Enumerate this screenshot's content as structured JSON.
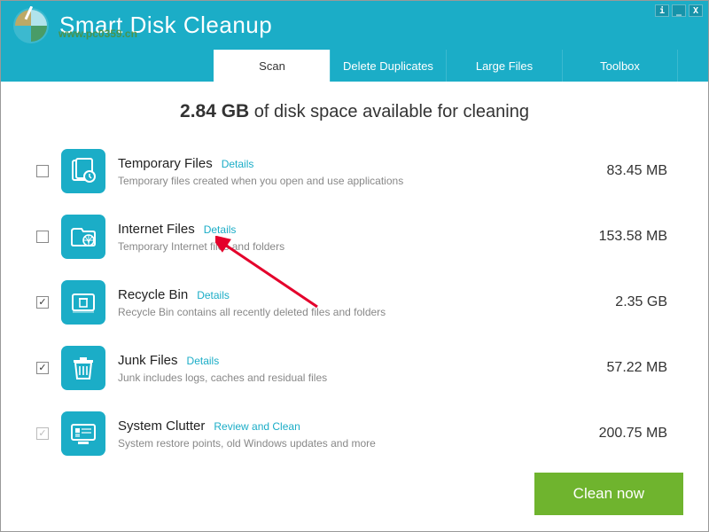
{
  "app_title": "Smart Disk Cleanup",
  "watermark": "www.pc0359.cn",
  "tabs": [
    {
      "label": "Scan",
      "active": true
    },
    {
      "label": "Delete Duplicates",
      "active": false
    },
    {
      "label": "Large Files",
      "active": false
    },
    {
      "label": "Toolbox",
      "active": false
    }
  ],
  "summary": {
    "amount": "2.84 GB",
    "suffix": " of disk space available for cleaning"
  },
  "items": [
    {
      "checked": false,
      "locked": false,
      "icon": "temp-icon",
      "title": "Temporary Files",
      "link": "Details",
      "desc": "Temporary files created when you open and use applications",
      "size": "83.45 MB"
    },
    {
      "checked": false,
      "locked": false,
      "icon": "internet-icon",
      "title": "Internet Files",
      "link": "Details",
      "desc": "Temporary Internet files and folders",
      "size": "153.58 MB"
    },
    {
      "checked": true,
      "locked": false,
      "icon": "recycle-icon",
      "title": "Recycle Bin",
      "link": "Details",
      "desc": "Recycle Bin contains all recently deleted files and folders",
      "size": "2.35 GB"
    },
    {
      "checked": true,
      "locked": false,
      "icon": "junk-icon",
      "title": "Junk Files",
      "link": "Details",
      "desc": "Junk includes logs, caches and residual files",
      "size": "57.22 MB"
    },
    {
      "checked": true,
      "locked": true,
      "icon": "system-icon",
      "title": "System Clutter",
      "link": "Review and Clean",
      "desc": "System restore points, old Windows updates and more",
      "size": "200.75 MB"
    }
  ],
  "clean_button": "Clean now",
  "window_controls": {
    "info": "i",
    "min": "_",
    "close": "X"
  }
}
